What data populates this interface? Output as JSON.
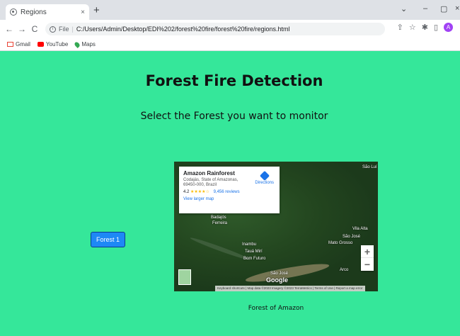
{
  "browser": {
    "tab_title": "Regions",
    "tab_close": "×",
    "new_tab": "+",
    "window_controls": [
      "⌄",
      "–",
      "▢",
      "×"
    ],
    "nav": {
      "back": "←",
      "forward": "→",
      "reload": "C"
    },
    "address": {
      "scheme_label": "File",
      "url": "C:/Users/Admin/Desktop/EDI%202/forest%20fire/forest%20fire/regions.html"
    },
    "toolbar_icons": [
      "share-icon",
      "star-icon",
      "extensions-icon",
      "sidepanel-icon"
    ],
    "profile_initial": "A",
    "bookmarks": [
      {
        "label": "Gmail",
        "icon": "gmail-icon"
      },
      {
        "label": "YouTube",
        "icon": "youtube-icon"
      },
      {
        "label": "Maps",
        "icon": "maps-icon"
      }
    ]
  },
  "page": {
    "title": "Forest Fire Detection",
    "subtitle": "Select the Forest you want to monitor",
    "forest_button": "Forest 1",
    "caption": "Forest of Amazon"
  },
  "map": {
    "place_title": "Amazon Rainforest",
    "address": "Codajás, State of Amazonas, 69450-000, Brazil",
    "rating": "4.2",
    "stars": "★★★★☆",
    "reviews": "9,456 reviews",
    "directions": "Directions",
    "view_larger": "View larger map",
    "zoom_in": "+",
    "zoom_out": "−",
    "google": "Google",
    "attribution": "Keyboard shortcuts | Map data ©2023 Imagery ©2023 TerraMetrics | Terms of Use | Report a map error",
    "places": [
      "São Luí",
      "Badajós",
      "Ferreira",
      "Vila Alta",
      "São José",
      "Mato Grosso",
      "Inambu",
      "Tauá Mirí",
      "Bom Futuro",
      "São José",
      "Arco"
    ]
  },
  "colors": {
    "page_background": "#35e79a",
    "button_blue": "#1e88f5"
  }
}
